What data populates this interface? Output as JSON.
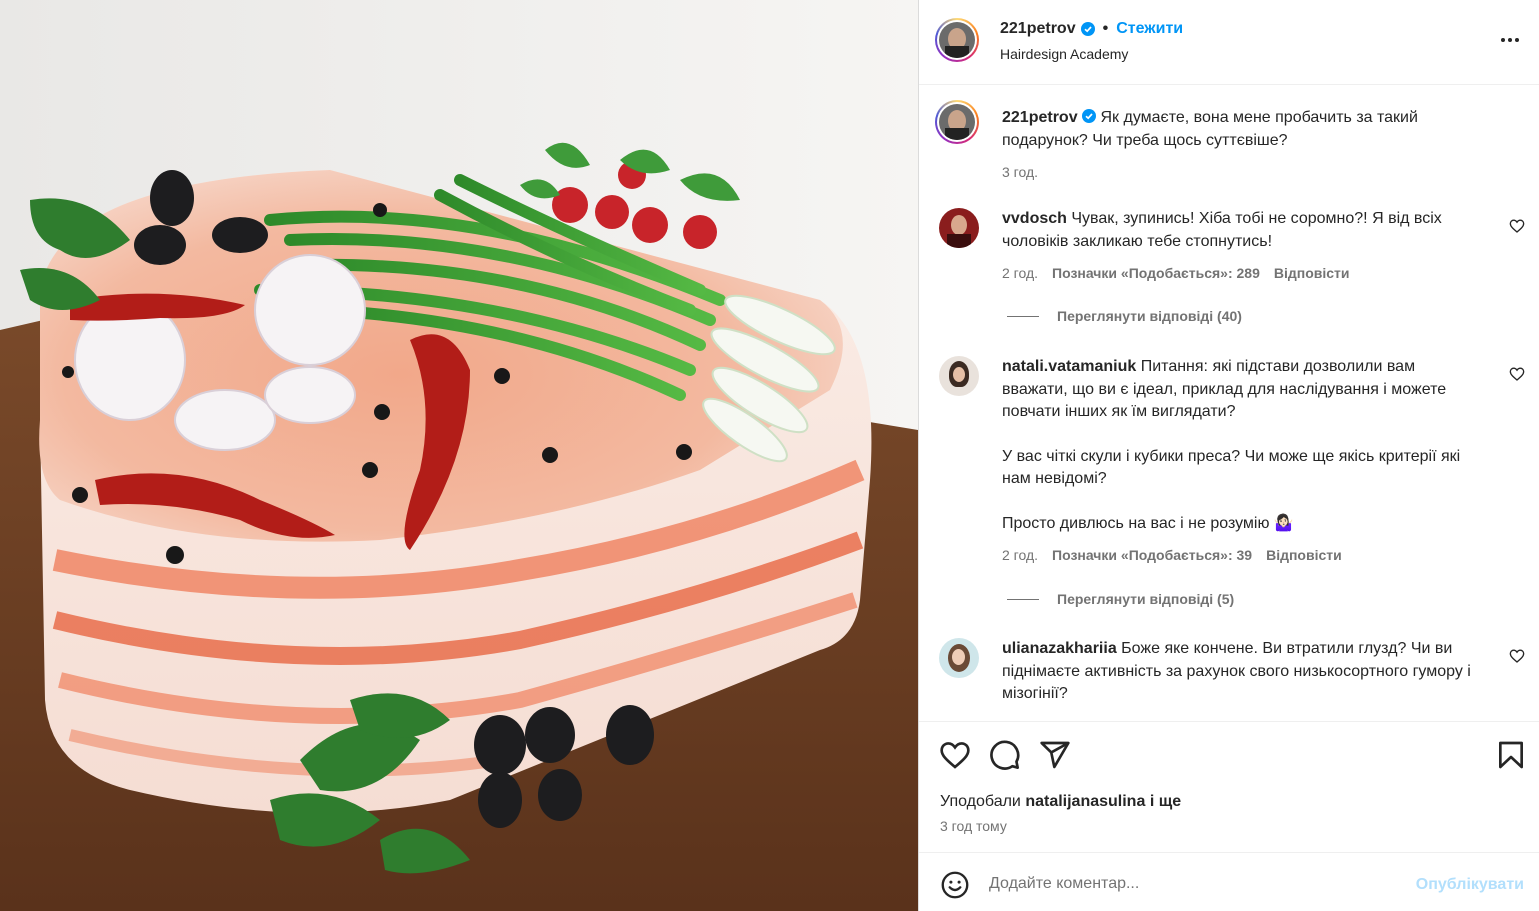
{
  "post": {
    "author": "221petrov",
    "follow_label": "Стежити",
    "location": "Hairdesign Academy",
    "separator": "•",
    "caption": {
      "user": "221petrov",
      "text": "Як думаєте, вона мене пробачить за такий подарунок? Чи треба щось суттєвіше?",
      "time": "3 год."
    }
  },
  "comments": [
    {
      "user": "vvdosch",
      "text": "Чувак, зупинись! Хіба тобі не соромно?! Я від всіх чоловіків закликаю тебе стопнутись!",
      "time": "2 год.",
      "likes": "Позначки «Подобається»: 289",
      "reply_label": "Відповісти",
      "view_replies": "Переглянути відповіді (40)"
    },
    {
      "user": "natali.vatamaniuk",
      "text": "Питання: які підстави дозволили вам вважати, що ви є ідеал, приклад для наслідування і можете повчати інших як їм виглядати?",
      "text2": "У вас чіткі скули і кубики преса? Чи може ще якісь критерії які нам невідомі?",
      "text3": "Просто дивлюсь на вас і не розумію 🤷🏻‍♀️",
      "time": "2 год.",
      "likes": "Позначки «Подобається»: 39",
      "reply_label": "Відповісти",
      "view_replies": "Переглянути відповіді (5)"
    },
    {
      "user": "ulianazakhariia",
      "text": "Боже яке кончене. Ви втратили глузд? Чи ви піднімаєте активність за рахунок свого низькосортного гумору і мізогінії?"
    }
  ],
  "actions": {
    "liked_by_prefix": "Уподобали",
    "liked_by_user": "natalijanasulina",
    "liked_by_suffix": "і ще",
    "time": "3 год тому"
  },
  "add_comment": {
    "placeholder": "Додайте коментар...",
    "publish_label": "Опублікувати"
  },
  "colors": {
    "accent": "#0095f6",
    "publish_disabled": "#b2dffc",
    "secondary_text": "#737373",
    "text": "#262626"
  }
}
